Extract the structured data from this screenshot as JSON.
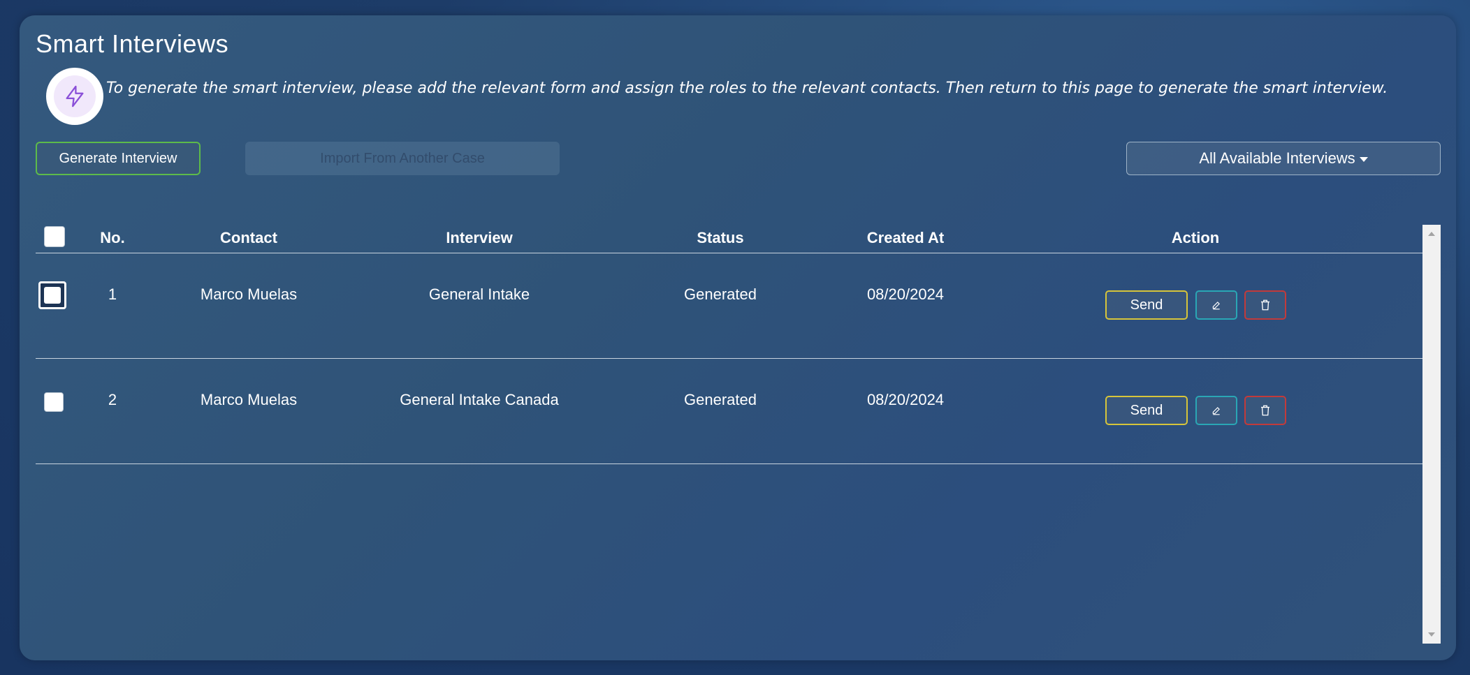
{
  "page": {
    "title": "Smart Interviews",
    "info_text": "To generate the smart interview, please add the relevant form and assign the roles to the relevant contacts. Then return to this page to generate the smart interview.",
    "info_icon": "lightning-bolt-icon"
  },
  "toolbar": {
    "generate_label": "Generate Interview",
    "import_label": "Import From Another Case",
    "filter_label": "All Available Interviews"
  },
  "table": {
    "headers": {
      "no": "No.",
      "contact": "Contact",
      "interview": "Interview",
      "status": "Status",
      "created_at": "Created At",
      "action": "Action"
    },
    "rows": [
      {
        "no": "1",
        "contact": "Marco Muelas",
        "interview": "General Intake",
        "status": "Generated",
        "created_at": "08/20/2024",
        "send_label": "Send"
      },
      {
        "no": "2",
        "contact": "Marco Muelas",
        "interview": "General Intake Canada",
        "status": "Generated",
        "created_at": "08/20/2024",
        "send_label": "Send"
      }
    ]
  },
  "colors": {
    "generate_border": "#5dbb4a",
    "send_border": "#d7c53a",
    "edit_border": "#2aa7b5",
    "delete_border": "#c33a3a",
    "icon_accent": "#8a4fd8"
  }
}
